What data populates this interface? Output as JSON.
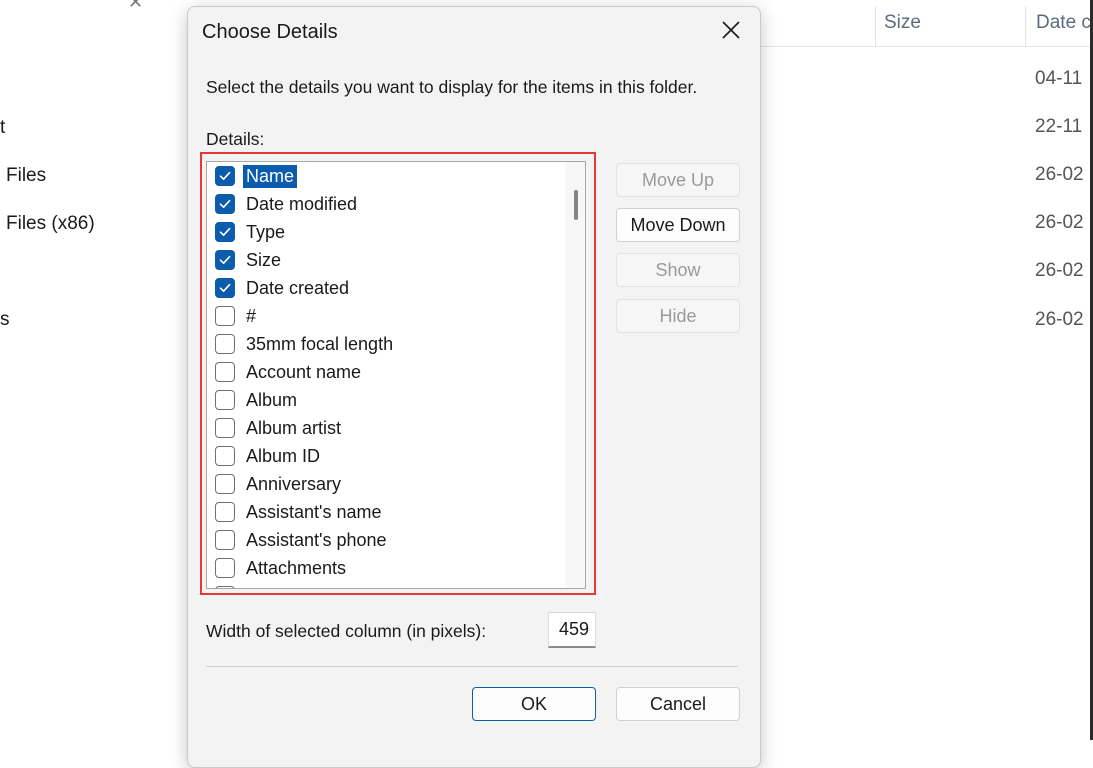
{
  "background": {
    "left_items": [
      "t",
      "Files",
      "Files (x86)",
      "s"
    ],
    "columns": [
      "Size",
      "Date c"
    ],
    "dates": [
      "04-11",
      "22-11",
      "26-02",
      "26-02",
      "26-02",
      "26-02"
    ]
  },
  "dialog": {
    "title": "Choose Details",
    "description": "Select the details you want to display for the items in this folder.",
    "details_label": "Details:",
    "items": [
      {
        "label": "Name",
        "checked": true,
        "selected": true
      },
      {
        "label": "Date modified",
        "checked": true,
        "selected": false
      },
      {
        "label": "Type",
        "checked": true,
        "selected": false
      },
      {
        "label": "Size",
        "checked": true,
        "selected": false
      },
      {
        "label": "Date created",
        "checked": true,
        "selected": false
      },
      {
        "label": "#",
        "checked": false,
        "selected": false
      },
      {
        "label": "35mm focal length",
        "checked": false,
        "selected": false
      },
      {
        "label": "Account name",
        "checked": false,
        "selected": false
      },
      {
        "label": "Album",
        "checked": false,
        "selected": false
      },
      {
        "label": "Album artist",
        "checked": false,
        "selected": false
      },
      {
        "label": "Album ID",
        "checked": false,
        "selected": false
      },
      {
        "label": "Anniversary",
        "checked": false,
        "selected": false
      },
      {
        "label": "Assistant's name",
        "checked": false,
        "selected": false
      },
      {
        "label": "Assistant's phone",
        "checked": false,
        "selected": false
      },
      {
        "label": "Attachments",
        "checked": false,
        "selected": false
      }
    ],
    "buttons": {
      "move_up": "Move Up",
      "move_down": "Move Down",
      "show": "Show",
      "hide": "Hide",
      "ok": "OK",
      "cancel": "Cancel"
    },
    "width_label": "Width of selected column (in pixels):",
    "width_value": "459",
    "accent_color": "#0b5cad",
    "highlight_color": "#e53935"
  }
}
